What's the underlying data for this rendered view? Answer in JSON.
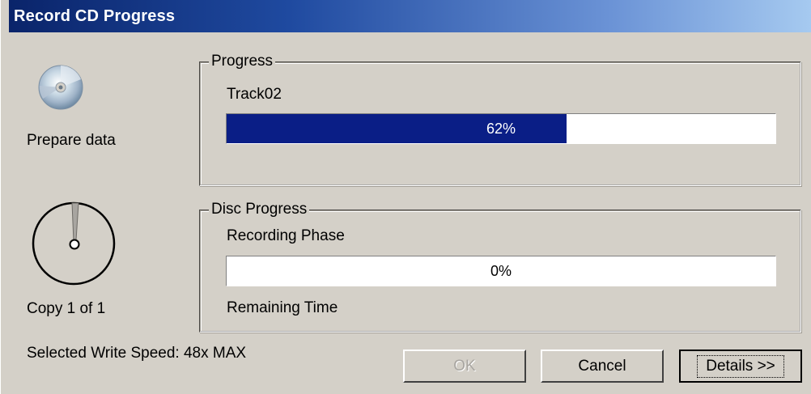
{
  "window": {
    "title": "Record CD Progress"
  },
  "left": {
    "status_label": "Prepare data",
    "copy_label": "Copy 1 of 1",
    "write_speed_label": "Selected Write Speed: 48x MAX"
  },
  "progress_group": {
    "legend": "Progress",
    "track_label": "Track02",
    "percent": 62,
    "percent_text": "62%"
  },
  "disc_group": {
    "legend": "Disc Progress",
    "phase_label": "Recording Phase",
    "percent": 0,
    "percent_text": "0%",
    "remaining_label": "Remaining Time"
  },
  "buttons": {
    "ok": "OK",
    "cancel": "Cancel",
    "details": "Details >>"
  },
  "icons": {
    "disc": "cd-disc-icon",
    "clock": "stopwatch-icon"
  },
  "colors": {
    "progress_fill": "#0a1e86",
    "title_start": "#0a246a",
    "title_end": "#a6caf0"
  }
}
